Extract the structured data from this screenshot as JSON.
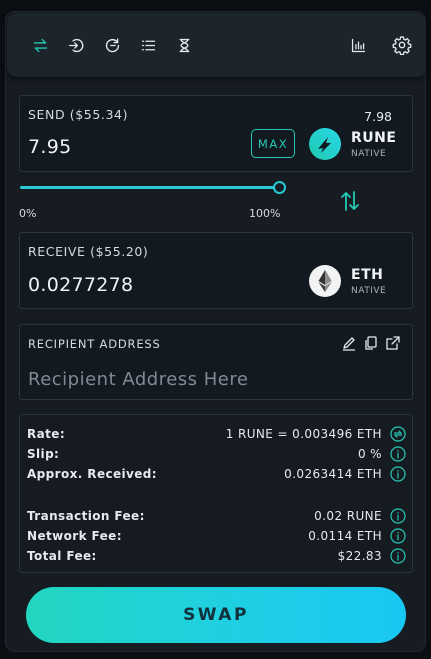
{
  "toolbar": {
    "icons": [
      "swap-arrows-icon",
      "login-icon",
      "refresh-icon",
      "list-icon",
      "hourglass-icon",
      "chart-icon",
      "gear-icon"
    ],
    "accent": "#26c9b6"
  },
  "send": {
    "label": "SEND ($55.34)",
    "amount": "7.95",
    "max_label": "MAX",
    "balance": "7.98",
    "token": "RUNE",
    "chain": "NATIVE"
  },
  "slider": {
    "value_percent": 100,
    "min_label": "0%",
    "max_label": "100%"
  },
  "receive": {
    "label": "RECEIVE ($55.20)",
    "amount": "0.0277278",
    "token": "ETH",
    "chain": "NATIVE"
  },
  "recipient": {
    "label": "RECIPIENT ADDRESS",
    "placeholder": "Recipient Address Here"
  },
  "details": {
    "rate_label": "Rate:",
    "rate_value": "1 RUNE = 0.003496 ETH",
    "slip_label": "Slip:",
    "slip_value": "0 %",
    "received_label": "Approx. Received:",
    "received_value": "0.0263414 ETH",
    "tx_fee_label": "Transaction Fee:",
    "tx_fee_value": "0.02 RUNE",
    "network_fee_label": "Network Fee:",
    "network_fee_value": "0.0114 ETH",
    "total_fee_label": "Total Fee:",
    "total_fee_value": "$22.83"
  },
  "swap_button": "SWAP"
}
